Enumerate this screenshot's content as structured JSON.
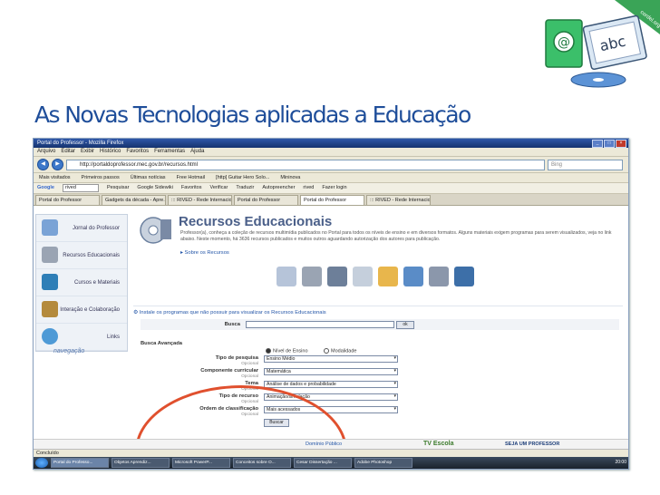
{
  "slide": {
    "title": "As Novas Tecnologias aplicadas a Educação"
  },
  "logo": {
    "screen_text": "abc",
    "at_symbol": "@",
    "ribbon": "cordel.org"
  },
  "browser": {
    "window_title": "Portal do Professor - Mozilla Firefox",
    "menu": [
      "Arquivo",
      "Editar",
      "Exibir",
      "Histórico",
      "Favoritos",
      "Ferramentas",
      "Ajuda"
    ],
    "url": "http://portaldoprofessor.mec.gov.br/recursos.html",
    "search_placeholder": "Bing",
    "bookmarks": [
      "Mais visitados",
      "Primeiros passos",
      "Últimas notícias",
      "Free Hotmail",
      "[http] Guitar Hero Solo...",
      "Mininova"
    ],
    "google_bar": {
      "logo": "Google",
      "query": "rived",
      "items": [
        "Pesquisar",
        "Google Sidewiki",
        "Favoritos",
        "Verificar",
        "Traduzir",
        "Autopreencher",
        "rived",
        "Fazer login"
      ]
    },
    "tabs": [
      "Portal do Professor",
      "Gadgets da década - Apre...",
      "::: RIVED - Rede Internacion...",
      "Portal do Professor",
      "Portal do Professor",
      "::: RIVED - Rede Internacion..."
    ],
    "active_tab_index": 4,
    "status": "Concluído"
  },
  "sidebar": {
    "items": [
      "Jornal do Professor",
      "Recursos Educacionais",
      "Cursos e Materiais",
      "Interação e Colaboração",
      "Links"
    ],
    "footer": "navegação"
  },
  "page": {
    "heading": "Recursos Educacionais",
    "description": "Professor(a), conheça a coleção de recursos multimídia publicados no Portal para todos os níveis de ensino e em diversos formatos. Alguns materiais exigem programas para serem visualizados, veja no link abaixo. Neste momento, há 3636 recursos publicados e muitos outros aguardando autorização dos autores para publicação.",
    "sobre_link": "Sobre os Recursos",
    "install_link": "Instale os programas que não possuir para visualizar os Recursos Educacionais",
    "busca_label": "Busca",
    "ok_label": "ok",
    "advanced_label": "Busca Avançada",
    "radio_ensino": "Nível de Ensino",
    "radio_modalidade": "Modalidade",
    "fields": [
      {
        "label": "Tipo de pesquisa",
        "value": "Ensino Médio",
        "optional": "Opcional"
      },
      {
        "label": "Componente curricular",
        "value": "Matemática",
        "optional": "Opcional"
      },
      {
        "label": "Tema",
        "value": "Análise de dados e probabilidade",
        "optional": "Opcional"
      },
      {
        "label": "Tipo de recurso",
        "value": "Animação/simulação",
        "optional": "Opcional"
      },
      {
        "label": "Ordem de classificação",
        "value": "Mais acessados",
        "optional": "Opcional"
      }
    ],
    "buscar_label": "Buscar",
    "footer_strip": [
      "Domínio Público",
      "TV Escola",
      "SEJA UM PROFESSOR"
    ]
  },
  "taskbar": {
    "items": [
      "Portal do Professo...",
      "Objetos Aprendiz...",
      "Microsoft PowerP...",
      "Conceitos sobre O...",
      "Cesar Dissertação ...",
      "Adobe Photoshop"
    ],
    "clock": "20:00"
  },
  "colors": {
    "title": "#1f4e9a",
    "highlight_oval": "#e0502e",
    "accent_link": "#2456a8"
  }
}
